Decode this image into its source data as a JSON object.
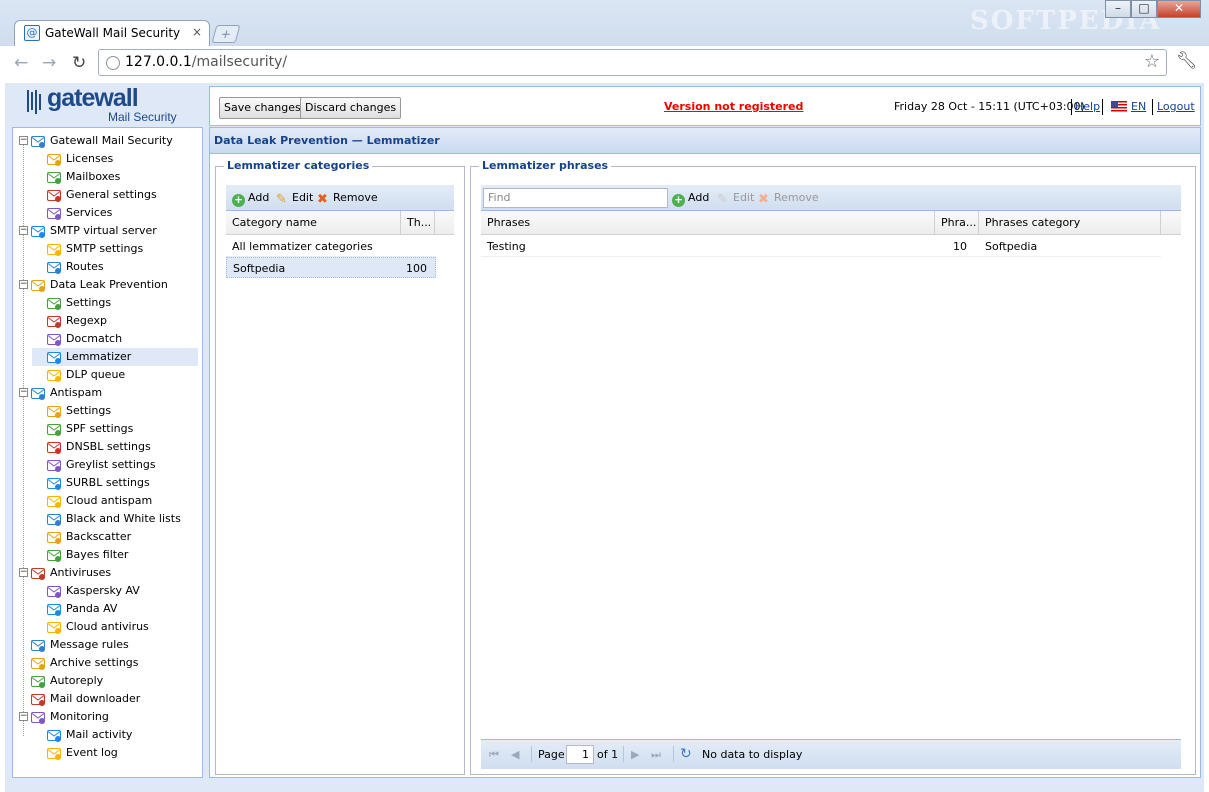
{
  "browser": {
    "tab_title": "GateWall Mail Security",
    "tab_favicon": "@",
    "tab_close": "×",
    "new_tab": "+",
    "url_host": "127.0.0.1",
    "url_path": "/mailsecurity/",
    "watermark": "SOFTPEDIA"
  },
  "logo": {
    "word": "gatewall",
    "sub": "Mail Security"
  },
  "topbar": {
    "save_label": "Save changes",
    "discard_label": "Discard changes",
    "registration": "Version not registered",
    "datetime": "Friday 28 Oct - 15:11 (UTC+03:00)",
    "help": "Help",
    "lang": "EN",
    "logout": "Logout"
  },
  "tree": [
    {
      "label": "Gatewall Mail Security",
      "icon": "gatewall-icon",
      "level": 0,
      "toggle": "−"
    },
    {
      "label": "Licenses",
      "icon": "info-icon",
      "level": 1
    },
    {
      "label": "Mailboxes",
      "icon": "mailbox-icon",
      "level": 1
    },
    {
      "label": "General settings",
      "icon": "general-settings-icon",
      "level": 1
    },
    {
      "label": "Services",
      "icon": "services-icon",
      "level": 1
    },
    {
      "label": "SMTP virtual server",
      "icon": "at-icon",
      "level": 0,
      "toggle": "−"
    },
    {
      "label": "SMTP settings",
      "icon": "smtp-settings-icon",
      "level": 1
    },
    {
      "label": "Routes",
      "icon": "routes-icon",
      "level": 1
    },
    {
      "label": "Data Leak Prevention",
      "icon": "dlp-icon",
      "level": 0,
      "toggle": "−"
    },
    {
      "label": "Settings",
      "icon": "settings-icon",
      "level": 1
    },
    {
      "label": "Regexp",
      "icon": "regexp-icon",
      "level": 1
    },
    {
      "label": "Docmatch",
      "icon": "docmatch-icon",
      "level": 1
    },
    {
      "label": "Lemmatizer",
      "icon": "lemmatizer-icon",
      "level": 1,
      "selected": true
    },
    {
      "label": "DLP queue",
      "icon": "dlp-queue-icon",
      "level": 1
    },
    {
      "label": "Antispam",
      "icon": "antispam-icon",
      "level": 0,
      "toggle": "−"
    },
    {
      "label": "Settings",
      "icon": "settings-icon",
      "level": 1
    },
    {
      "label": "SPF settings",
      "icon": "spf-icon",
      "level": 1
    },
    {
      "label": "DNSBL settings",
      "icon": "dnsbl-icon",
      "level": 1
    },
    {
      "label": "Greylist settings",
      "icon": "greylist-icon",
      "level": 1
    },
    {
      "label": "SURBL settings",
      "icon": "surbl-icon",
      "level": 1
    },
    {
      "label": "Cloud antispam",
      "icon": "cloud-antispam-icon",
      "level": 1
    },
    {
      "label": "Black and White lists",
      "icon": "lists-icon",
      "level": 1
    },
    {
      "label": "Backscatter",
      "icon": "backscatter-icon",
      "level": 1
    },
    {
      "label": "Bayes filter",
      "icon": "bayes-icon",
      "level": 1
    },
    {
      "label": "Antiviruses",
      "icon": "antivirus-icon",
      "level": 0,
      "toggle": "−"
    },
    {
      "label": "Kaspersky AV",
      "icon": "kaspersky-icon",
      "level": 1
    },
    {
      "label": "Panda AV",
      "icon": "panda-icon",
      "level": 1
    },
    {
      "label": "Cloud antivirus",
      "icon": "cloud-antivirus-icon",
      "level": 1
    },
    {
      "label": "Message rules",
      "icon": "message-rules-icon",
      "level": 0
    },
    {
      "label": "Archive settings",
      "icon": "archive-icon",
      "level": 0
    },
    {
      "label": "Autoreply",
      "icon": "autoreply-icon",
      "level": 0
    },
    {
      "label": "Mail downloader",
      "icon": "mail-downloader-icon",
      "level": 0
    },
    {
      "label": "Monitoring",
      "icon": "monitoring-icon",
      "level": 0,
      "toggle": "−"
    },
    {
      "label": "Mail activity",
      "icon": "mail-activity-icon",
      "level": 1
    },
    {
      "label": "Event log",
      "icon": "event-log-icon",
      "level": 1
    }
  ],
  "main": {
    "title": "Data Leak Prevention — Lemmatizer",
    "categories": {
      "legend": "Lemmatizer categories",
      "add": "Add",
      "edit": "Edit",
      "remove": "Remove",
      "columns": [
        "Category name",
        "Th..."
      ],
      "rows": [
        {
          "name": "All lemmatizer categories",
          "value": ""
        },
        {
          "name": "Softpedia",
          "value": "100"
        }
      ]
    },
    "phrases": {
      "legend": "Lemmatizer phrases",
      "find_placeholder": "Find",
      "add": "Add",
      "edit": "Edit",
      "remove": "Remove",
      "columns": [
        "Phrases",
        "Phra...",
        "Phrases category"
      ],
      "rows": [
        {
          "phrase": "Testing",
          "value": "10",
          "category": "Softpedia"
        }
      ],
      "pager": {
        "page_label": "Page",
        "page": "1",
        "of": "of 1",
        "status": "No data to display"
      }
    }
  },
  "colors": {
    "accent": "#15428b",
    "panel_border": "#99bbe8",
    "warning": "#e00000",
    "selection": "#dfe8f6"
  }
}
